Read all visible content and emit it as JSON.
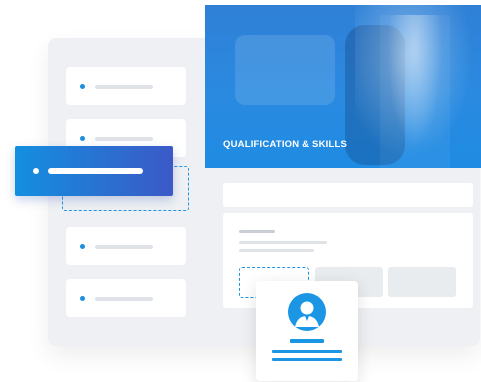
{
  "hero": {
    "title": "QUALIFICATION & SKILLS"
  },
  "list": {
    "items": [
      {
        "state": "normal"
      },
      {
        "state": "normal"
      },
      {
        "state": "active"
      },
      {
        "state": "normal"
      },
      {
        "state": "normal"
      }
    ]
  },
  "colors": {
    "accent": "#1e8fe0",
    "gradient_start": "#148fdf",
    "gradient_end": "#3b59c7",
    "panel": "#eef0f3",
    "placeholder": "#dfe3e8"
  },
  "profile": {
    "icon": "user-avatar-icon"
  }
}
